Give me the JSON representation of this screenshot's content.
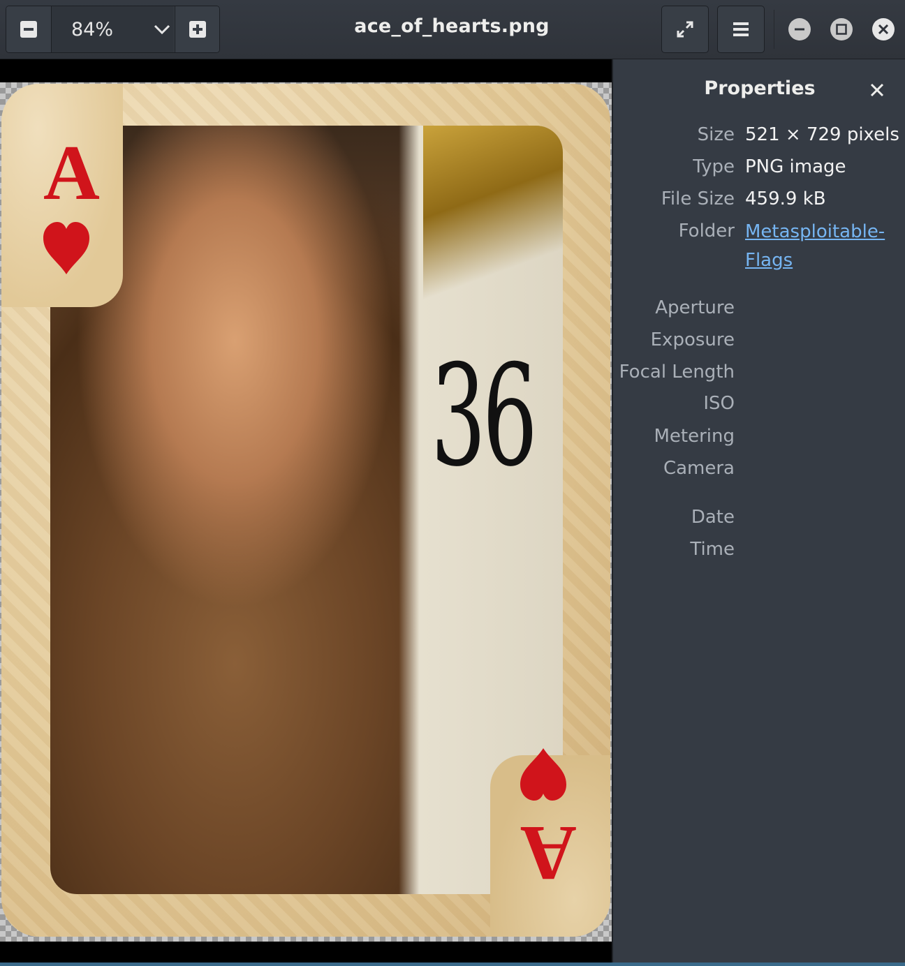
{
  "window": {
    "title": "ace_of_hearts.png"
  },
  "zoom": {
    "value": "84%"
  },
  "headerbar": {
    "zoom_out_icon": "minus-icon",
    "zoom_in_icon": "plus-icon",
    "fullscreen_icon": "fullscreen-icon",
    "menu_icon": "hamburger-menu-icon"
  },
  "image": {
    "rank": "A",
    "suit": "heart",
    "accent_color": "#d0141b"
  },
  "properties": {
    "title": "Properties",
    "rows": [
      {
        "label": "Size",
        "value": "521 × 729 pixels"
      },
      {
        "label": "Type",
        "value": "PNG image"
      },
      {
        "label": "File Size",
        "value": "459.9 kB"
      },
      {
        "label": "Folder",
        "value": "Metasploitable-Flags"
      }
    ],
    "empty_rows": [
      "Aperture",
      "Exposure",
      "Focal Length",
      "ISO",
      "Metering",
      "Camera",
      "Date",
      "Time"
    ]
  },
  "colors": {
    "header_bg": "#353a42",
    "sidebar_bg": "#353b44",
    "link": "#76b5f2"
  }
}
